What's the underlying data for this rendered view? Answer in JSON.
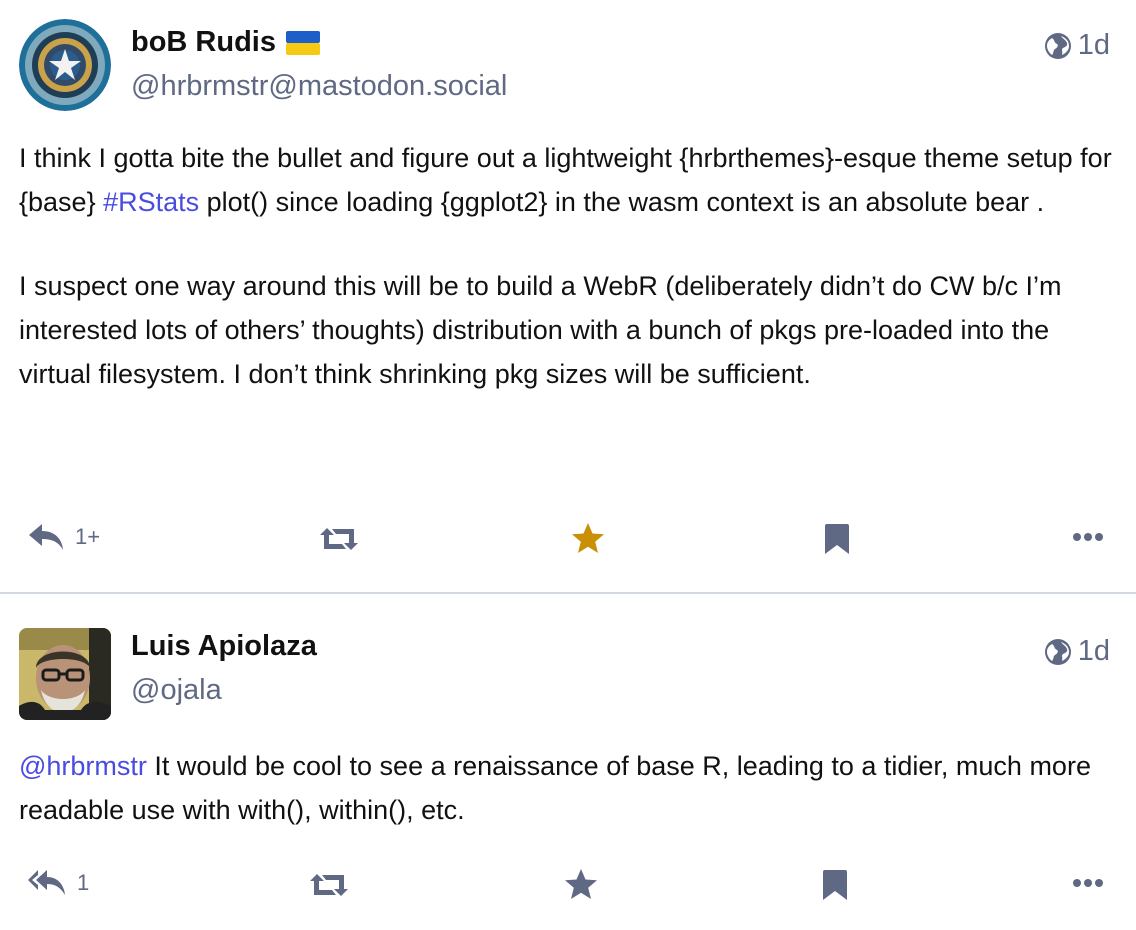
{
  "posts": [
    {
      "author": {
        "display_name": "boB Rudis",
        "flag_icon": "ukraine-flag",
        "handle": "@hrbrmstr@mastodon.social",
        "avatar_icon": "captain-america-shield-avatar"
      },
      "visibility_icon": "globe-icon",
      "time": "1d",
      "paragraphs": [
        {
          "pre": "I think I gotta bite the bullet and figure out a lightweight {hrbrthemes}-esque theme setup for {base} ",
          "hashtag": "#RStats",
          "post": " plot() since loading {ggplot2} in the wasm context is an absolute bear ."
        },
        {
          "text": "I suspect one way around this will be to build a WebR (deliberately didn’t do CW b/c I’m interested lots of others’ thoughts) distribution with a bunch of pkgs pre-loaded into the virtual filesystem.  I don’t think shrinking pkg sizes will be sufficient."
        }
      ],
      "actions": {
        "reply_icon": "reply-icon",
        "reply_count": "1+",
        "boost_icon": "boost-icon",
        "favourite_icon": "star-icon",
        "favourite_color": "#ca8f04",
        "bookmark_icon": "bookmark-icon",
        "more_icon": "more-icon"
      }
    },
    {
      "author": {
        "display_name": "Luis Apiolaza",
        "handle": "@ojala",
        "avatar_icon": "person-photo-avatar"
      },
      "visibility_icon": "globe-icon",
      "time": "1d",
      "mention": "@hrbrmstr",
      "text": " It would be cool to see a renaissance of base R, leading to a tidier, much more readable use with with(), within(), etc.",
      "actions": {
        "reply_icon": "reply-all-icon",
        "reply_count": "1",
        "boost_icon": "boost-icon",
        "favourite_icon": "star-icon",
        "favourite_color": "#606984",
        "bookmark_icon": "bookmark-icon",
        "more_icon": "more-icon"
      }
    }
  ]
}
